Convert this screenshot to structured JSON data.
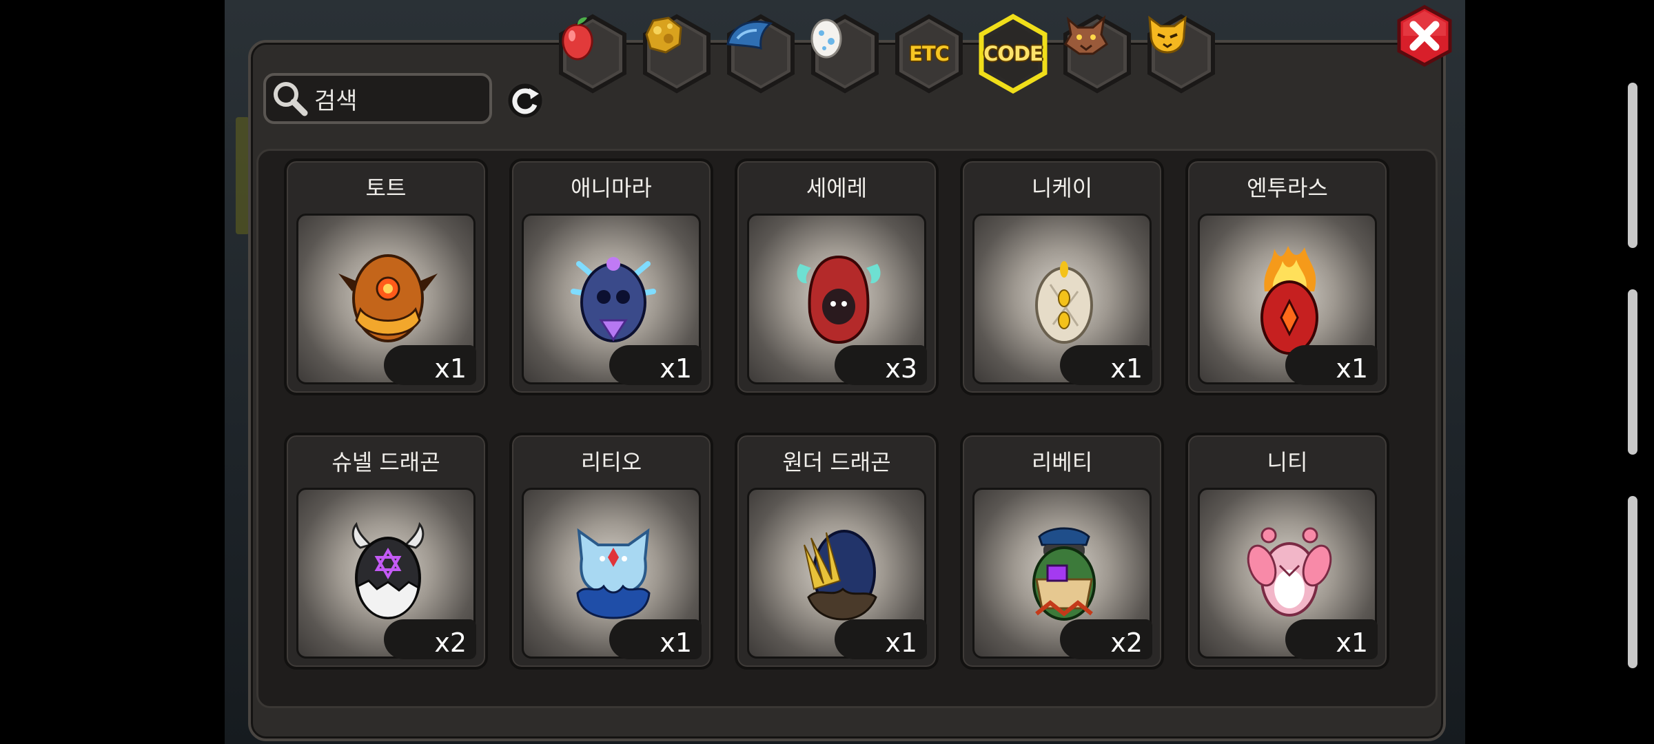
{
  "search": {
    "placeholder": "검색"
  },
  "tabs": [
    {
      "id": "fruit",
      "icon": "fruit-icon",
      "label": ""
    },
    {
      "id": "gold",
      "icon": "gold-nugget-icon",
      "label": ""
    },
    {
      "id": "scale",
      "icon": "dragon-scale-icon",
      "label": ""
    },
    {
      "id": "egg",
      "icon": "egg-icon",
      "label": ""
    },
    {
      "id": "etc",
      "icon": "",
      "label": "ETC"
    },
    {
      "id": "code",
      "icon": "",
      "label": "CODE",
      "active": true
    },
    {
      "id": "beast",
      "icon": "wolf-head-icon",
      "label": ""
    },
    {
      "id": "emote",
      "icon": "cat-face-icon",
      "label": ""
    }
  ],
  "items": [
    {
      "name": "토트",
      "qty": "x1",
      "egg_icon": "tot-egg-icon",
      "color": "#c4651a"
    },
    {
      "name": "애니마라",
      "qty": "x1",
      "egg_icon": "animara-egg-icon",
      "color": "#3a4a8a"
    },
    {
      "name": "세에레",
      "qty": "x3",
      "egg_icon": "seere-egg-icon",
      "color": "#b42a2a"
    },
    {
      "name": "니케이",
      "qty": "x1",
      "egg_icon": "nikei-egg-icon",
      "color": "#e6dcc8"
    },
    {
      "name": "엔투라스",
      "qty": "x1",
      "egg_icon": "enturas-egg-icon",
      "color": "#c62020"
    },
    {
      "name": "슈넬 드래곤",
      "qty": "x2",
      "egg_icon": "schnell-dragon-egg-icon",
      "color": "#2a2a2e"
    },
    {
      "name": "리티오",
      "qty": "x1",
      "egg_icon": "litio-egg-icon",
      "color": "#a8d8f2"
    },
    {
      "name": "원더 드래곤",
      "qty": "x1",
      "egg_icon": "wonder-dragon-egg-icon",
      "color": "#22346a"
    },
    {
      "name": "리베티",
      "qty": "x2",
      "egg_icon": "liberty-egg-icon",
      "color": "#3c7a3a"
    },
    {
      "name": "니티",
      "qty": "x1",
      "egg_icon": "niti-egg-icon",
      "color": "#f2b6c8"
    }
  ],
  "colors": {
    "panel": "#2e2c2a",
    "accent": "#f0de1a",
    "close": "#d81f2a"
  }
}
